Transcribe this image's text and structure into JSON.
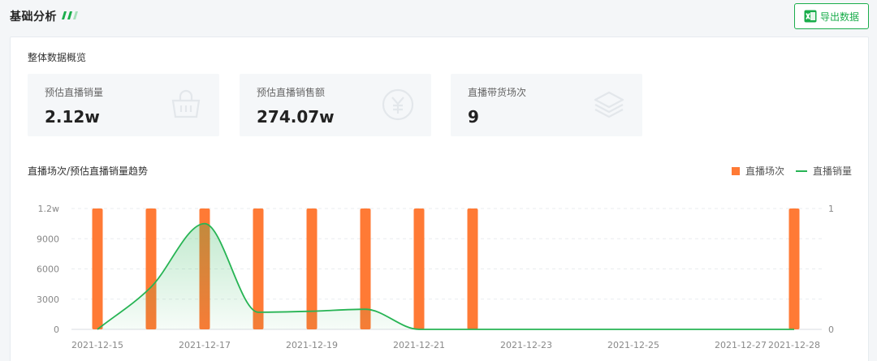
{
  "header": {
    "title": "基础分析",
    "export_label": "导出数据"
  },
  "overview": {
    "title": "整体数据概览",
    "stats": [
      {
        "label": "预估直播销量",
        "value": "2.12w"
      },
      {
        "label": "预估直播销售额",
        "value": "274.07w"
      },
      {
        "label": "直播带货场次",
        "value": "9"
      }
    ]
  },
  "colors": {
    "accent": "#1aad4b",
    "bar": "#ff7a35",
    "line": "#27b454"
  },
  "chart_data": {
    "type": "bar",
    "title": "直播场次/预估直播销量趋势",
    "legend_position": "top-right",
    "legend": [
      "直播场次",
      "直播销量"
    ],
    "categories": [
      "2021-12-15",
      "2021-12-16",
      "2021-12-17",
      "2021-12-18",
      "2021-12-19",
      "2021-12-20",
      "2021-12-21",
      "2021-12-22",
      "2021-12-23",
      "2021-12-24",
      "2021-12-25",
      "2021-12-26",
      "2021-12-27",
      "2021-12-28"
    ],
    "x_tick_labels": [
      "2021-12-15",
      "2021-12-17",
      "2021-12-19",
      "2021-12-21",
      "2021-12-23",
      "2021-12-25",
      "2021-12-27",
      "2021-12-28"
    ],
    "y_left_ticks": [
      "0",
      "3000",
      "6000",
      "9000",
      "1.2w"
    ],
    "y_right_ticks": [
      "0",
      "1"
    ],
    "y_left_lim": [
      0,
      12000
    ],
    "y_right_lim": [
      0,
      1
    ],
    "grid": true,
    "series": [
      {
        "name": "直播场次",
        "kind": "bar",
        "axis": "right",
        "values": [
          1,
          1,
          1,
          1,
          1,
          1,
          1,
          1,
          0,
          0,
          0,
          0,
          0,
          1
        ]
      },
      {
        "name": "直播销量",
        "kind": "line",
        "axis": "left",
        "values": [
          0,
          4200,
          10500,
          1700,
          1800,
          2000,
          0,
          0,
          0,
          0,
          0,
          0,
          0,
          0
        ]
      }
    ]
  }
}
